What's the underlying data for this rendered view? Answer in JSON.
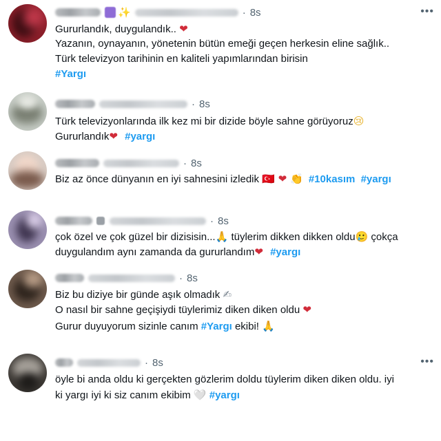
{
  "more_icon": "more-horizontal-icon",
  "colors": {
    "hashtag": "#1d9bf0",
    "heart": "#d12c3a",
    "meta": "#536471"
  },
  "tweets": [
    {
      "time": "8s",
      "lines": [
        {
          "text": "Gururlandık, duygulandık..",
          "emoji": "❤"
        },
        {
          "text": "Yazanın, oynayanın, yönetenin bütün emeği geçen herkesin eline sağlık.."
        },
        {
          "text": "Türk televizyon tarihinin en kaliteli yapımlarından birisin"
        },
        {
          "tag": "#Yargı"
        }
      ]
    },
    {
      "time": "8s",
      "lines": [
        {
          "text": "Türk televizyonlarında ilk kez mi bir dizide böyle sahne görüyoruz",
          "emoji": "😢"
        },
        {
          "text": "Gururlandık",
          "emoji": "❤",
          "tag": "#yargı"
        }
      ]
    },
    {
      "time": "8s",
      "lines": [
        {
          "text": "Biz az önce dünyanın en iyi sahnesini izledik",
          "emoji": "🇹🇷 ❤ 👏",
          "tag": "#10kasım",
          "tag2": "#yargı"
        }
      ]
    },
    {
      "time": "8s",
      "lines": [
        {
          "text": "çok özel ve çok güzel bir dizisisin...",
          "emoji": "🙏",
          "text2": "tüylerim dikken dikken oldu",
          "emoji2": "🥲",
          "text3": "çokça"
        },
        {
          "text": "duygulandım aynı zamanda da gururlandım",
          "emoji": "❤",
          "tag": "#yargı"
        }
      ]
    },
    {
      "time": "8s",
      "lines": [
        {
          "text": "Biz bu diziye bir günde aşık olmadık",
          "emoji": "✍"
        },
        {
          "text": "O nasıl bir sahne geçişiydi tüylerimiz diken diken oldu",
          "emoji": "❤"
        },
        {
          "text": "Gurur duyuyorum sizinle canım",
          "tag": "#Yargı",
          "text2": "ekibi!",
          "emoji": "🙏"
        }
      ]
    },
    {
      "time": "8s",
      "lines": [
        {
          "text": "öyle bi anda oldu ki gerçekten gözlerim doldu tüylerim diken diken oldu. iyi"
        },
        {
          "text": "ki yargı iyi ki siz canım ekibim",
          "emoji": "🤍",
          "tag": "#yargı"
        }
      ]
    }
  ]
}
